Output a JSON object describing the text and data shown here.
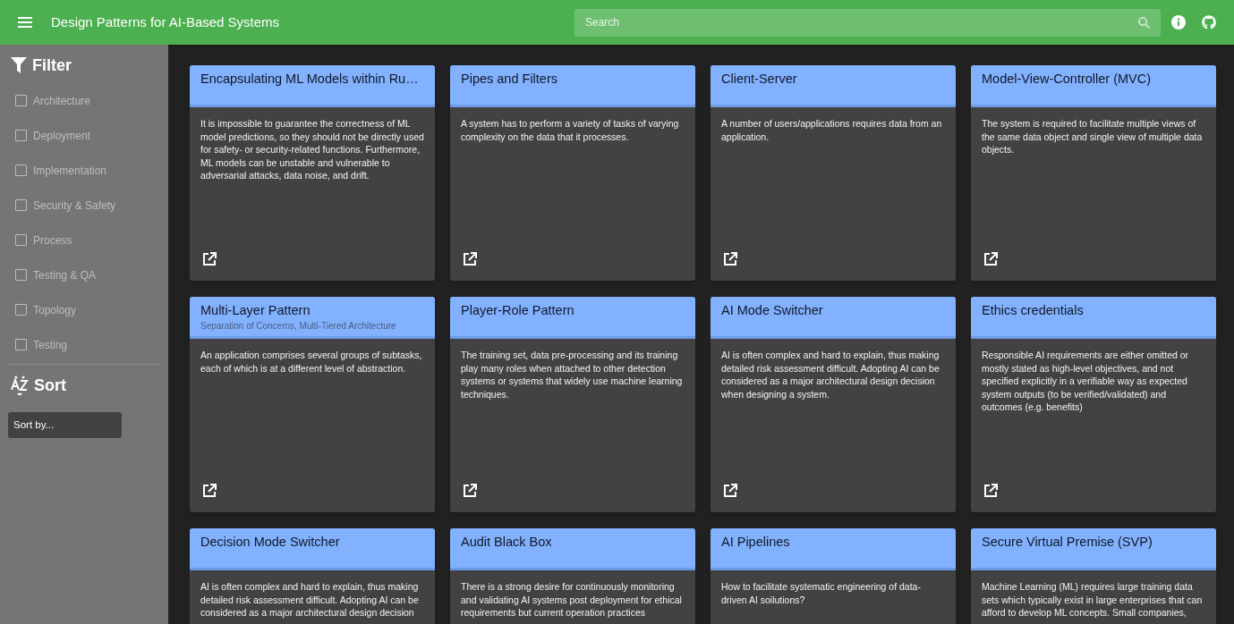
{
  "app_bar": {
    "title": "Design Patterns for AI-Based Systems",
    "search": {
      "placeholder": "Search"
    }
  },
  "sidebar": {
    "filter_heading": "Filter",
    "filters": [
      {
        "label": "Architecture",
        "checked": false
      },
      {
        "label": "Deployment",
        "checked": false
      },
      {
        "label": "Implementation",
        "checked": false
      },
      {
        "label": "Security & Safety",
        "checked": false
      },
      {
        "label": "Process",
        "checked": false
      },
      {
        "label": "Testing & QA",
        "checked": false
      },
      {
        "label": "Topology",
        "checked": false
      },
      {
        "label": "Testing",
        "checked": false
      }
    ],
    "sort_heading": "Sort",
    "sort_select": {
      "placeholder": "Sort by..."
    }
  },
  "cards": [
    {
      "title": "Encapsulating ML Models within Ru…",
      "description": "It is impossible to guarantee the correctness of ML model predictions, so they should not be directly used for safety- or security-related functions. Furthermore, ML models can be unstable and vulnerable to adversarial attacks, data noise, and drift."
    },
    {
      "title": "Pipes and Filters",
      "description": "A system has to perform a variety of tasks of varying complexity on the data that it processes."
    },
    {
      "title": "Client-Server",
      "description": "A number of users/applications requires data from an application."
    },
    {
      "title": "Model-View-Controller (MVC)",
      "description": "The system is required to facilitate multiple views of the same data object and single view of multiple data objects."
    },
    {
      "title": "Multi-Layer Pattern",
      "subtitle": "Separation of Concerns, Multi-Tiered Architecture",
      "description": "An application comprises several groups of subtasks, each of which is at a different level of abstraction."
    },
    {
      "title": "Player-Role Pattern",
      "description": "The training set, data pre-processing and its training play many roles when attached to other detection systems or systems that widely use machine learning techniques."
    },
    {
      "title": "AI Mode Switcher",
      "description": "AI is often complex and hard to explain, thus making detailed risk assessment difficult. Adopting AI can be considered as a major architectural design decision when designing a system."
    },
    {
      "title": "Ethics credentials",
      "description": "Responsible AI requirements are either omitted or mostly stated as high-level objectives, and not specified explicitly in a verifiable way as expected system outputs (to be verified/validated) and outcomes (e.g. benefits)"
    },
    {
      "title": "Decision Mode Switcher",
      "description": "AI is often complex and hard to explain, thus making detailed risk assessment difficult. Adopting AI can be considered as a major architectural design decision"
    },
    {
      "title": "Audit Black Box",
      "description": "There is a strong desire for continuously monitoring and validating AI systems post deployment for ethical requirements but current operation practices"
    },
    {
      "title": "AI Pipelines",
      "description": "How to facilitate systematic engineering of data-driven AI soilutions?"
    },
    {
      "title": "Secure Virtual Premise (SVP)",
      "description": "Machine Learning (ML) requires large training data sets which typically exist in large enterprises that can afford to develop ML concepts. Small companies,"
    }
  ]
}
